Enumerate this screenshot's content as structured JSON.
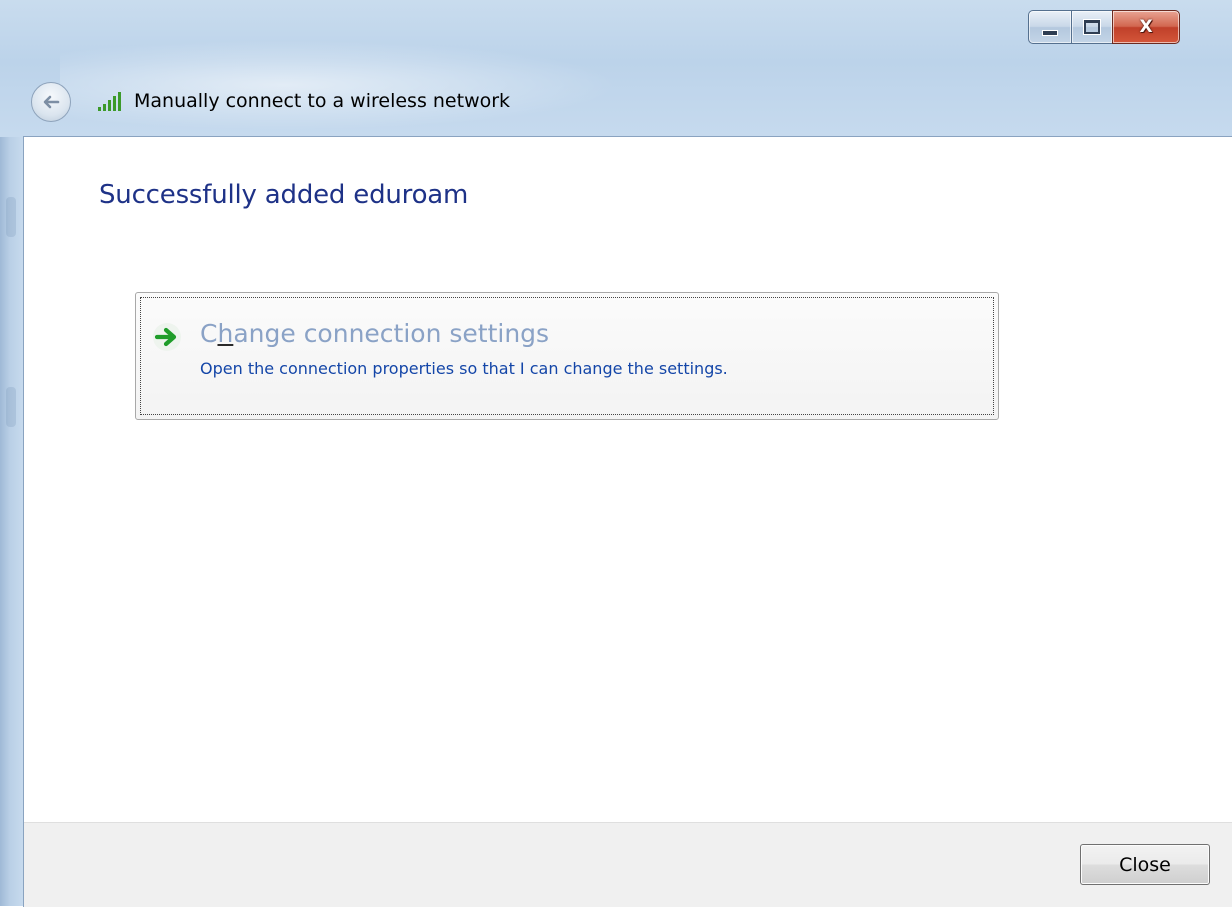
{
  "window": {
    "title": "Manually connect to a wireless network",
    "caption_buttons": {
      "minimize_icon": "minimize-icon",
      "maximize_icon": "maximize-icon",
      "close_glyph": "X"
    }
  },
  "nav": {
    "back_icon": "back-arrow-icon",
    "title_icon": "wireless-signal-icon"
  },
  "main": {
    "heading": "Successfully added eduroam",
    "command_link": {
      "title_before": "C",
      "title_accel": "h",
      "title_after": "ange connection settings",
      "description": "Open the connection properties so that I can change the settings.",
      "icon": "green-arrow-icon"
    }
  },
  "footer": {
    "close_label": "Close"
  },
  "colors": {
    "heading": "#1e3287",
    "link_title": "#8aa2c6",
    "link_desc": "#1446a8",
    "frame": "#bcd3ea"
  }
}
